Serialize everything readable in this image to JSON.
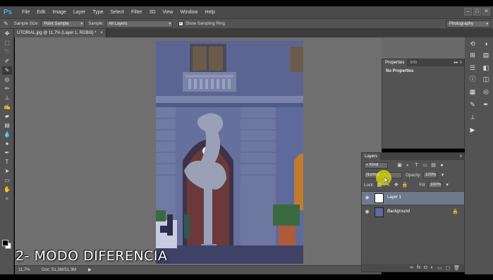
{
  "app": {
    "logo": "Ps"
  },
  "menu": [
    "File",
    "Edit",
    "Image",
    "Layer",
    "Type",
    "Select",
    "Filter",
    "3D",
    "View",
    "Window",
    "Help"
  ],
  "window_controls": [
    "–",
    "□",
    "✕"
  ],
  "options": {
    "sample_size_label": "Sample Size:",
    "sample_size_value": "Point Sample",
    "sample_label": "Sample:",
    "sample_value": "All Layers",
    "show_ring_label": "Show Sampling Ring",
    "workspace": "Photography"
  },
  "document_tab": {
    "title": "UTORIAL.jpg @ 11,7% (Layer 1, RGB/8) *",
    "close": "×"
  },
  "tools": [
    "move-icon",
    "marquee-icon",
    "lasso-icon",
    "quick-select-icon",
    "eyedropper-icon",
    "spot-healing-icon",
    "brush-icon",
    "clone-stamp-icon",
    "history-brush-icon",
    "eraser-icon",
    "gradient-icon",
    "blur-icon",
    "dodge-icon",
    "pen-icon",
    "type-icon",
    "path-select-icon",
    "shape-icon",
    "hand-icon",
    "zoom-icon"
  ],
  "status": {
    "zoom": "11,7%",
    "doc": "Doc: 51,3M/51,3M",
    "arrow": "▶"
  },
  "caption": "2- MODO DIFERENCIA",
  "properties_panel": {
    "tabs": [
      "Properties",
      "Info"
    ],
    "body": "No Properties"
  },
  "layers_panel": {
    "tab": "Layers",
    "filter_value": "Kind",
    "blend_mode": "Normal",
    "opacity_label": "Opacity:",
    "opacity_value": "100%",
    "lock_label": "Lock:",
    "fill_label": "Fill:",
    "fill_value": "100%",
    "layers": [
      {
        "name": "Layer 1",
        "selected": true
      },
      {
        "name": "Background",
        "selected": false
      }
    ],
    "footer_icons": [
      "link-icon",
      "fx-icon",
      "mask-icon",
      "adjustment-icon",
      "group-icon",
      "new-layer-icon",
      "trash-icon"
    ]
  },
  "colors": {
    "accent": "#3fa9f5",
    "highlight": "#dcdc00",
    "panel": "#535353",
    "canvas": "#6f6f6f"
  }
}
